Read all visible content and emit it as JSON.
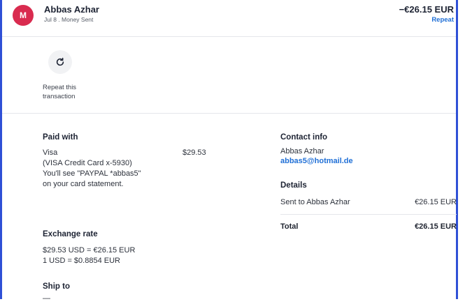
{
  "header": {
    "avatar_letter": "M",
    "name": "Abbas Azhar",
    "subtitle": "Jul 8 . Money Sent",
    "amount": "−€26.15 EUR",
    "repeat_link": "Repeat"
  },
  "repeat_section": {
    "icon": "refresh-icon",
    "label": "Repeat this transaction"
  },
  "paid_with": {
    "heading": "Paid with",
    "description": "Visa\n(VISA Credit Card x-5930)\nYou'll see \"PAYPAL *abbas5\" on your card statement.",
    "amount": "$29.53"
  },
  "exchange_rate": {
    "heading": "Exchange rate",
    "line1": "$29.53 USD = €26.15 EUR",
    "line2": "1 USD = $0.8854 EUR"
  },
  "ship_to": {
    "heading": "Ship to",
    "value": "—"
  },
  "contact_info": {
    "heading": "Contact info",
    "name": "Abbas Azhar",
    "email": "abbas5@hotmail.de"
  },
  "details": {
    "heading": "Details",
    "row_label": "Sent to Abbas Azhar",
    "row_value": "€26.15 EUR",
    "total_label": "Total",
    "total_value": "€26.15 EUR"
  },
  "colors": {
    "avatar": "#d92b4f",
    "link": "#1f6fd6",
    "frame": "#2f50d6"
  }
}
